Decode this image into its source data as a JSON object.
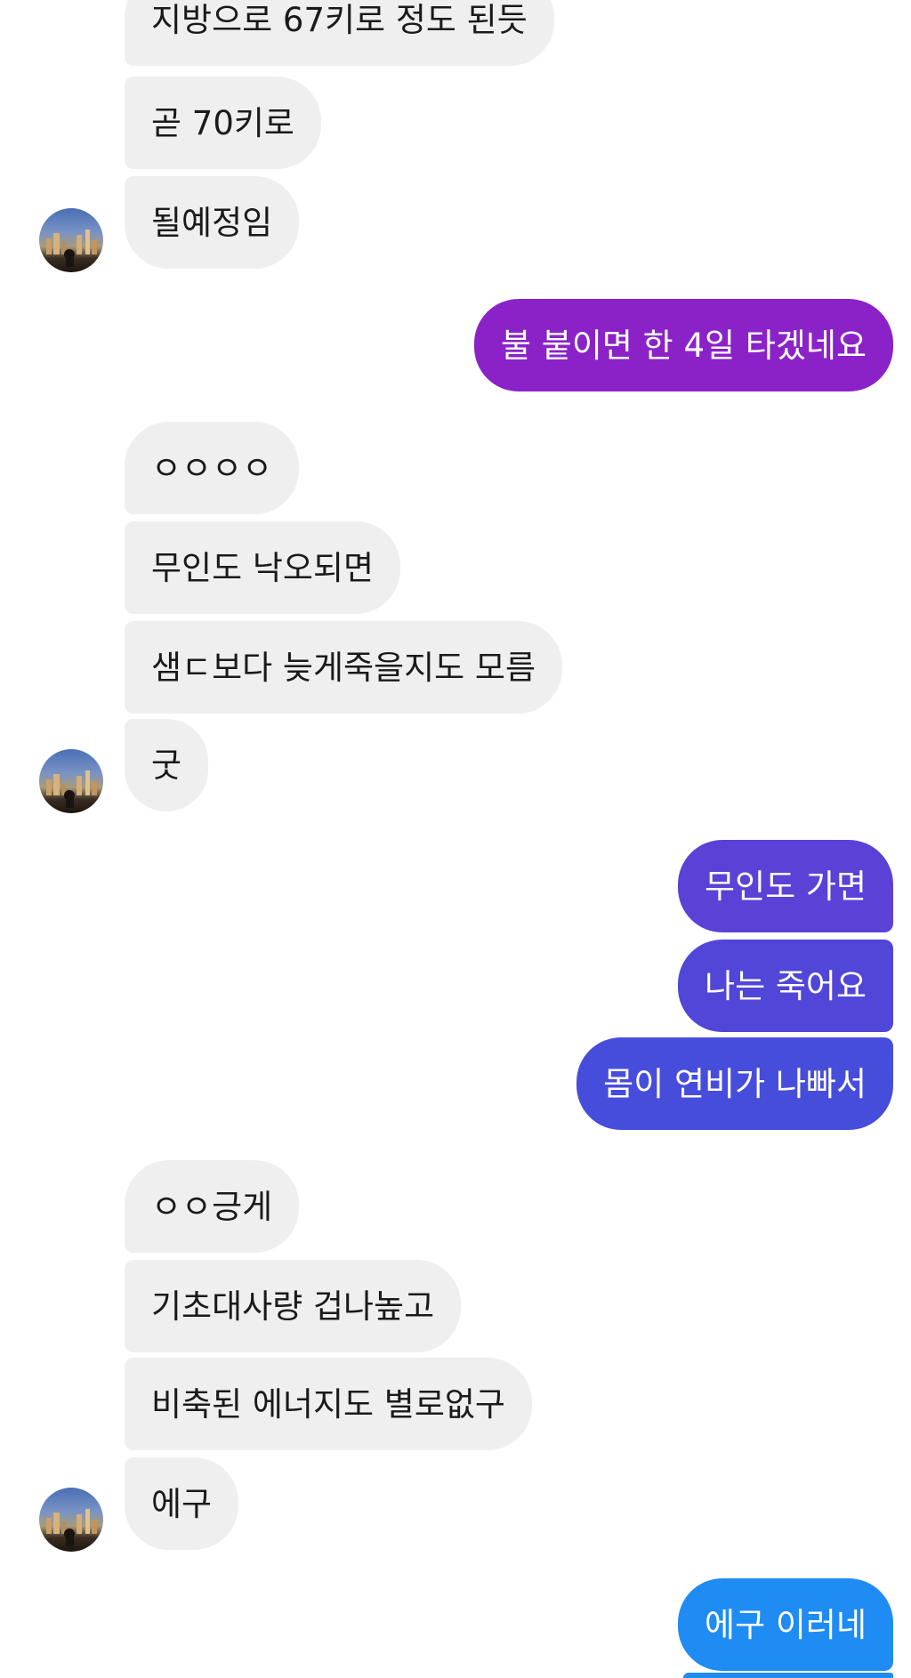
{
  "messages": {
    "group1": [
      "지방으로 67키로 정도 된듯",
      "곧 70키로",
      "될예정임"
    ],
    "sent1": "불 붙이면 한 4일 타겠네요",
    "group2": [
      "ㅇㅇㅇㅇ",
      "무인도 낙오되면",
      "샘ㄷ보다 늦게죽을지도 모름",
      "굿"
    ],
    "group3": [
      "무인도 가면",
      "나는 죽어요",
      "몸이 연비가 나빠서"
    ],
    "group4": [
      "ㅇㅇ긍게",
      "기초대사량 겁나높고",
      "비축된 에너지도 별로없구",
      "에구"
    ],
    "sent2": "에구 이러네"
  },
  "colors": {
    "received_bg": "#efefef",
    "received_text": "#1a1a1a",
    "sent_text": "#ffffff",
    "sent1_bg": "#8a22c8",
    "group3_bg_top": "#5b41d6",
    "group3_bg_mid": "#5146d8",
    "group3_bg_bottom": "#474ddb",
    "sent2_bg": "#1e8cf2"
  },
  "icons": {
    "avatar": "city-skyline-avatar-icon"
  }
}
